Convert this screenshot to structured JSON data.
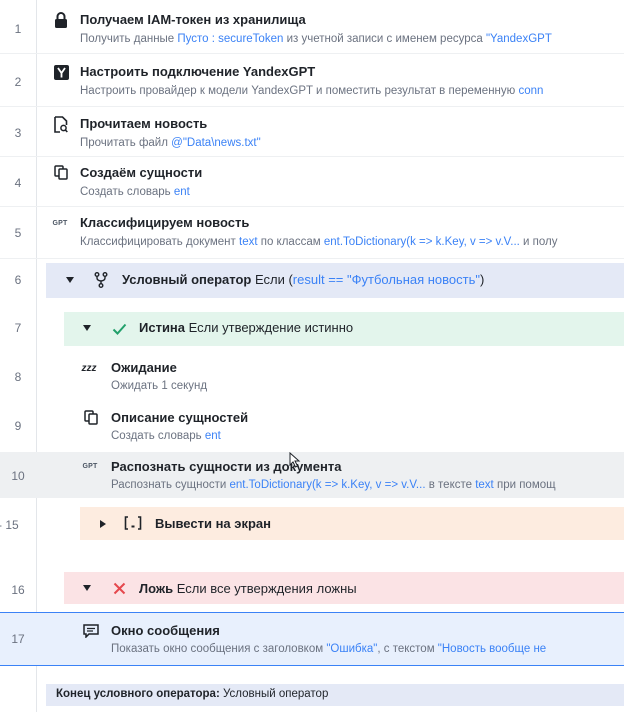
{
  "steps": [
    {
      "num": "1",
      "title": "Получаем IAM-токен из хранилища",
      "sub_a": "Получить данные ",
      "sub_b": "Пусто : secureToken",
      "sub_c": " из учетной записи с именем ресурса ",
      "sub_d": "\"YandexGPT"
    },
    {
      "num": "2",
      "title": "Настроить подключение YandexGPT",
      "sub_a": "Настроить провайдер к модели YandexGPT и поместить результат в переменную ",
      "sub_b": "conn"
    },
    {
      "num": "3",
      "title": "Прочитаем новость",
      "sub_a": "Прочитать файл ",
      "sub_b": "@\"Data\\news.txt\""
    },
    {
      "num": "4",
      "title": "Создаём сущности",
      "sub_a": "Создать словарь ",
      "sub_b": "ent"
    },
    {
      "num": "5",
      "title": "Классифицируем новость",
      "sub_a": "Классифицировать документ ",
      "sub_b": "text",
      "sub_c": " по классам ",
      "sub_d": "ent.ToDictionary(k => k.Key, v => v.V...",
      "sub_e": " и полу"
    },
    {
      "num": "6",
      "title": "Условный оператор",
      "cond_a": " Если (",
      "cond_b": "result == \"Футбольная новость\"",
      "cond_c": ")"
    },
    {
      "num": "7",
      "title": "Истина",
      "cond_a": " Если утверждение истинно"
    },
    {
      "num": "8",
      "title": "Ожидание",
      "sub_a": "Ожидать 1 секунд"
    },
    {
      "num": "9",
      "title": "Описание сущностей",
      "sub_a": "Создать словарь ",
      "sub_b": "ent"
    },
    {
      "num": "10",
      "title": "Распознать сущности из документа",
      "sub_a": "Распознать сущности ",
      "sub_b": "ent.ToDictionary(k => k.Key, v => v.V...",
      "sub_c": " в тексте ",
      "sub_d": "text",
      "sub_e": " при помощ"
    },
    {
      "num": "- 15",
      "title": "Вывести на экран"
    },
    {
      "num": "16",
      "title": "Ложь",
      "cond_a": " Если все утверждения ложны"
    },
    {
      "num": "17",
      "title": "Окно сообщения",
      "sub_a": "Показать окно сообщения с заголовком ",
      "sub_b": "\"Ошибка\"",
      "sub_c": ", с текстом ",
      "sub_d": "\"Новость вообще не"
    }
  ],
  "footer": {
    "label": "Конец условного оператора:",
    "value": "Условный оператор"
  },
  "icons": {
    "1": "lock-icon",
    "2": "yandex-icon",
    "3": "file-read-icon",
    "4": "copy-icon",
    "5": "gpt-icon",
    "6": "branch-icon",
    "7": "checkmark-icon",
    "8": "sleep-icon",
    "9": "copy-icon",
    "10": "gpt-icon",
    "15": "bracket-icon",
    "16": "cross-icon",
    "17": "message-icon"
  },
  "gpt_label": "GPT",
  "zzz_label": "zzz",
  "colors": {
    "link": "#3b82f6",
    "condition_band": "#e4e9f6",
    "true_band": "#e3f5ec",
    "false_band": "#fbe3e5",
    "output_band": "#fdece0",
    "selected_row": "#e8f0fd",
    "selected_border": "#3b82f6",
    "hover_row": "#eef0f2",
    "check": "#22a06b",
    "cross": "#e5484d"
  }
}
